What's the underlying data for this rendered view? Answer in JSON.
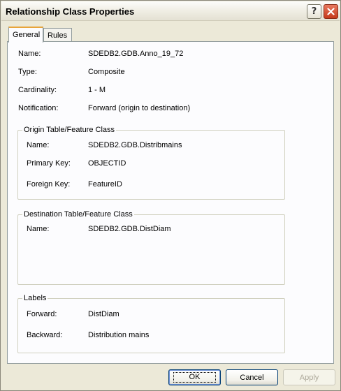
{
  "window": {
    "title": "Relationship Class Properties"
  },
  "tabs": [
    {
      "label": "General",
      "active": true
    },
    {
      "label": "Rules",
      "active": false
    }
  ],
  "general": {
    "name_label": "Name:",
    "name_value": "SDEDB2.GDB.Anno_19_72",
    "type_label": "Type:",
    "type_value": "Composite",
    "cardinality_label": "Cardinality:",
    "cardinality_value": "1 - M",
    "notification_label": "Notification:",
    "notification_value": "Forward (origin to destination)"
  },
  "origin": {
    "title": "Origin Table/Feature Class",
    "name_label": "Name:",
    "name_value": "SDEDB2.GDB.Distribmains",
    "primary_key_label": "Primary Key:",
    "primary_key_value": "OBJECTID",
    "foreign_key_label": "Foreign Key:",
    "foreign_key_value": "FeatureID"
  },
  "destination": {
    "title": "Destination Table/Feature Class",
    "name_label": "Name:",
    "name_value": "SDEDB2.GDB.DistDiam"
  },
  "labels": {
    "title": "Labels",
    "forward_label": "Forward:",
    "forward_value": "DistDiam",
    "backward_label": "Backward:",
    "backward_value": "Distribution mains"
  },
  "buttons": {
    "ok": "OK",
    "cancel": "Cancel",
    "apply": "Apply"
  },
  "titlebar_buttons": {
    "help": "?"
  }
}
